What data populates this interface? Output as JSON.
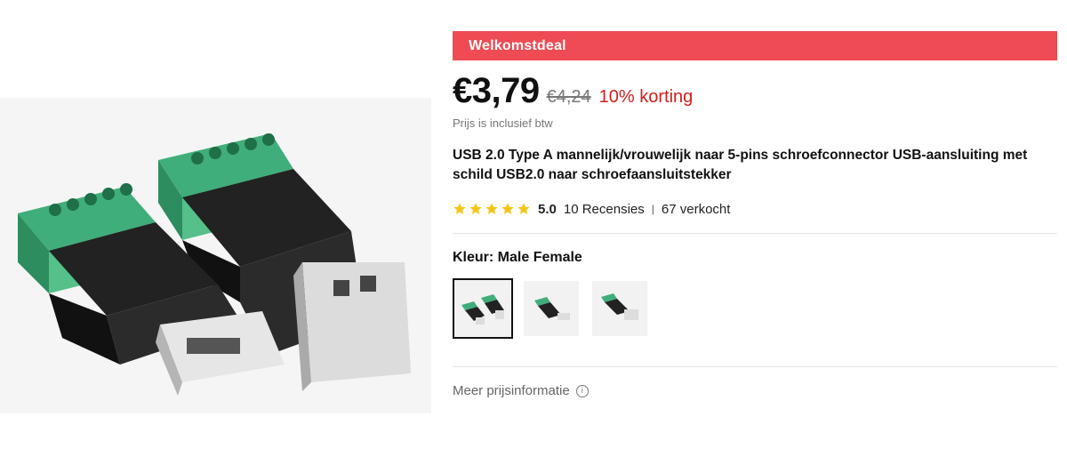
{
  "banner": {
    "label": "Welkomstdeal",
    "color": "#ef4b54"
  },
  "price": {
    "current": "€3,79",
    "original": "€4,24",
    "discount": "10% korting",
    "tax_note": "Prijs is inclusief btw"
  },
  "product": {
    "title": "USB 2.0 Type A mannelijk/vrouwelijk naar 5-pins schroefconnector USB-aansluiting met schild USB2.0 naar schroefaansluitstekker",
    "image_icon": "usb-screw-terminal-adapter-image"
  },
  "rating": {
    "stars": 5,
    "score": "5.0",
    "reviews": "10 Recensies",
    "separator": "|",
    "sold": "67 verkocht",
    "star_color": "#f5c518"
  },
  "variant": {
    "label": "Kleur: Male Female",
    "options": [
      "both-adapters",
      "male-adapter",
      "female-adapter"
    ],
    "selected_index": 0
  },
  "more_price_info": {
    "label": "Meer prijsinformatie",
    "icon": "info-icon",
    "glyph": "i"
  }
}
